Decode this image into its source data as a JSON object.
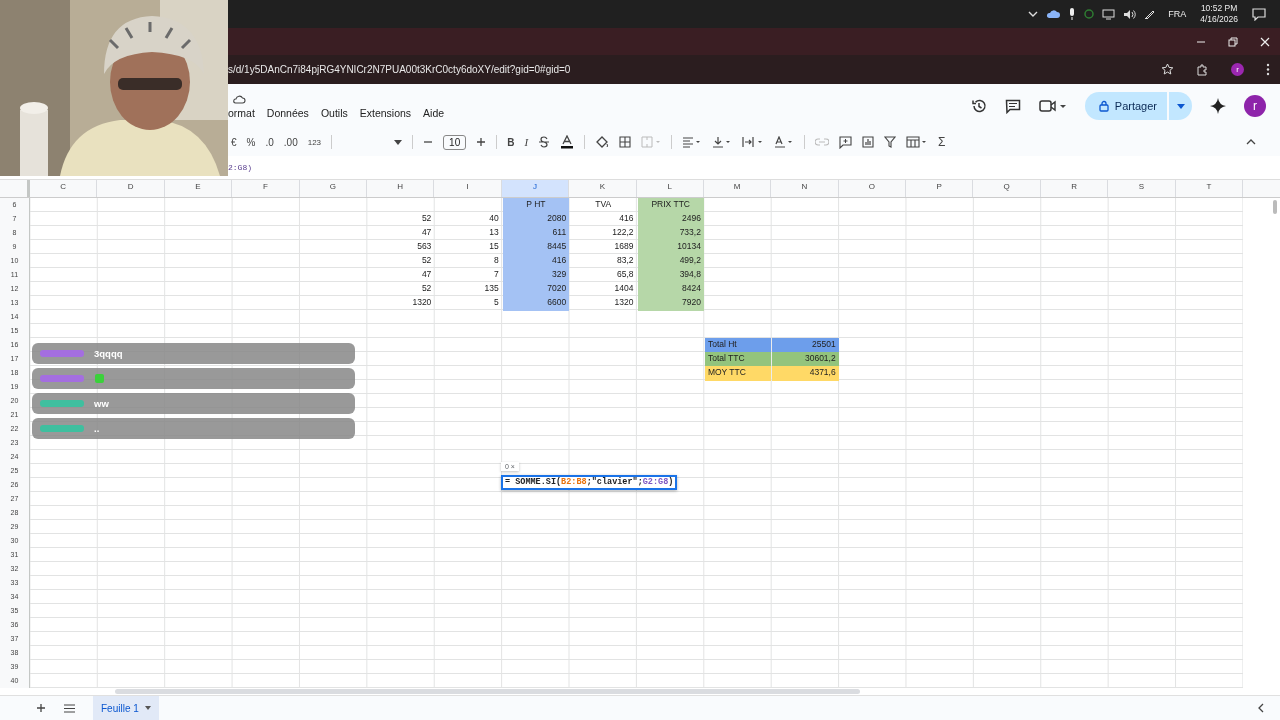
{
  "taskbar": {
    "language": "FRA",
    "time": "10:52 PM",
    "date": "4/16/2026"
  },
  "browser": {
    "url": "s/d/1y5DAnCn7i84pjRG4YNICr2N7PUA00t3KrC0cty6doXY/edit?gid=0#gid=0",
    "profile": "r"
  },
  "menu": [
    "ormat",
    "Données",
    "Outils",
    "Extensions",
    "Aide"
  ],
  "share": {
    "label": "Partager",
    "avatar": "r"
  },
  "toolbar": {
    "currency": "€",
    "percent": "%",
    "dec_less": ".0",
    "dec_more": ".00",
    "number_format": "123",
    "font_size": "10",
    "bold": "B",
    "italic": "I",
    "sum": "Σ"
  },
  "formula_bar": {
    "text": "2:G8)"
  },
  "columns": [
    {
      "label": "C",
      "selected": false
    },
    {
      "label": "D",
      "selected": false
    },
    {
      "label": "E",
      "selected": false
    },
    {
      "label": "F",
      "selected": false
    },
    {
      "label": "G",
      "selected": false
    },
    {
      "label": "H",
      "selected": false
    },
    {
      "label": "I",
      "selected": false
    },
    {
      "label": "J",
      "selected": true
    },
    {
      "label": "K",
      "selected": false
    },
    {
      "label": "L",
      "selected": false
    },
    {
      "label": "M",
      "selected": false
    },
    {
      "label": "N",
      "selected": false
    },
    {
      "label": "O",
      "selected": false
    },
    {
      "label": "P",
      "selected": false
    },
    {
      "label": "Q",
      "selected": false
    },
    {
      "label": "R",
      "selected": false
    },
    {
      "label": "S",
      "selected": false
    },
    {
      "label": "T",
      "selected": false
    }
  ],
  "rows": [
    {
      "number": "6",
      "cells": [
        null,
        null,
        null,
        null,
        null,
        null,
        null,
        {
          "text": "P HT",
          "kind": "header",
          "color": "#a4c2f4"
        },
        {
          "text": "TVA",
          "kind": "header"
        },
        {
          "text": "PRIX TTC",
          "kind": "header",
          "color": "#b6d7a8"
        }
      ]
    },
    {
      "number": "7",
      "cells": [
        null,
        null,
        null,
        null,
        null,
        {
          "text": "52",
          "kind": "number"
        },
        {
          "text": "40",
          "kind": "number"
        },
        {
          "text": "2080",
          "kind": "number",
          "color": "#a4c2f4"
        },
        {
          "text": "416",
          "kind": "number"
        },
        {
          "text": "2496",
          "kind": "number",
          "color": "#b6d7a8"
        }
      ]
    },
    {
      "number": "8",
      "cells": [
        null,
        null,
        null,
        null,
        null,
        {
          "text": "47",
          "kind": "number"
        },
        {
          "text": "13",
          "kind": "number"
        },
        {
          "text": "611",
          "kind": "number",
          "color": "#a4c2f4"
        },
        {
          "text": "122,2",
          "kind": "number"
        },
        {
          "text": "733,2",
          "kind": "number",
          "color": "#b6d7a8"
        }
      ]
    },
    {
      "number": "9",
      "cells": [
        null,
        null,
        null,
        null,
        null,
        {
          "text": "563",
          "kind": "number"
        },
        {
          "text": "15",
          "kind": "number"
        },
        {
          "text": "8445",
          "kind": "number",
          "color": "#a4c2f4"
        },
        {
          "text": "1689",
          "kind": "number"
        },
        {
          "text": "10134",
          "kind": "number",
          "color": "#b6d7a8"
        }
      ]
    },
    {
      "number": "10",
      "cells": [
        null,
        null,
        null,
        null,
        null,
        {
          "text": "52",
          "kind": "number"
        },
        {
          "text": "8",
          "kind": "number"
        },
        {
          "text": "416",
          "kind": "number",
          "color": "#a4c2f4"
        },
        {
          "text": "83,2",
          "kind": "number"
        },
        {
          "text": "499,2",
          "kind": "number",
          "color": "#b6d7a8"
        }
      ]
    },
    {
      "number": "11",
      "cells": [
        null,
        null,
        null,
        null,
        null,
        {
          "text": "47",
          "kind": "number"
        },
        {
          "text": "7",
          "kind": "number"
        },
        {
          "text": "329",
          "kind": "number",
          "color": "#a4c2f4"
        },
        {
          "text": "65,8",
          "kind": "number"
        },
        {
          "text": "394,8",
          "kind": "number",
          "color": "#b6d7a8"
        }
      ]
    },
    {
      "number": "12",
      "cells": [
        null,
        null,
        null,
        null,
        null,
        {
          "text": "52",
          "kind": "number"
        },
        {
          "text": "135",
          "kind": "number"
        },
        {
          "text": "7020",
          "kind": "number",
          "color": "#a4c2f4"
        },
        {
          "text": "1404",
          "kind": "number"
        },
        {
          "text": "8424",
          "kind": "number",
          "color": "#b6d7a8"
        }
      ]
    },
    {
      "number": "13",
      "cells": [
        null,
        null,
        null,
        null,
        null,
        {
          "text": "1320",
          "kind": "number"
        },
        {
          "text": "5",
          "kind": "number"
        },
        {
          "text": "6600",
          "kind": "number",
          "color": "#a4c2f4"
        },
        {
          "text": "1320",
          "kind": "number"
        },
        {
          "text": "7920",
          "kind": "number",
          "color": "#b6d7a8"
        }
      ]
    },
    {
      "number": "14"
    },
    {
      "number": "15"
    },
    {
      "number": "16",
      "cells": [
        null,
        null,
        null,
        null,
        null,
        null,
        null,
        null,
        null,
        null,
        {
          "text": "Total Ht",
          "kind": "label",
          "color": "#6d9eeb"
        },
        {
          "text": "25501",
          "kind": "number",
          "color": "#6d9eeb"
        }
      ]
    },
    {
      "number": "17",
      "cells": [
        null,
        null,
        null,
        null,
        null,
        null,
        null,
        null,
        null,
        null,
        {
          "text": "Total TTC",
          "kind": "label",
          "color": "#93c47d"
        },
        {
          "text": "30601,2",
          "kind": "number",
          "color": "#93c47d"
        }
      ]
    },
    {
      "number": "18",
      "cells": [
        null,
        null,
        null,
        null,
        null,
        null,
        null,
        null,
        null,
        null,
        {
          "text": "MOY TTC",
          "kind": "label",
          "color": "#ffd966"
        },
        {
          "text": "4371,6",
          "kind": "number",
          "color": "#ffd966"
        }
      ]
    },
    {
      "number": "19"
    },
    {
      "number": "20"
    },
    {
      "number": "21"
    },
    {
      "number": "22"
    },
    {
      "number": "23"
    },
    {
      "number": "24"
    },
    {
      "number": "25"
    },
    {
      "number": "26"
    },
    {
      "number": "27"
    },
    {
      "number": "28"
    },
    {
      "number": "29"
    },
    {
      "number": "30"
    },
    {
      "number": "31"
    },
    {
      "number": "32"
    },
    {
      "number": "33"
    },
    {
      "number": "34"
    },
    {
      "number": "35"
    },
    {
      "number": "36"
    },
    {
      "number": "37"
    },
    {
      "number": "38"
    },
    {
      "number": "39"
    },
    {
      "number": "40"
    }
  ],
  "cell_editor": {
    "hint": "0 ×",
    "parts": [
      {
        "text": "= SOMME.SI("
      },
      {
        "text": "B2:B8",
        "color": "#e8710a"
      },
      {
        "text": ";\"clavier\";"
      },
      {
        "text": "G2:G8",
        "color": "#7e57c2"
      },
      {
        "text": ")"
      }
    ]
  },
  "chat": [
    {
      "message": "3qqqq",
      "color": "#a46ee0",
      "kind": "text"
    },
    {
      "color": "#a46ee0",
      "kind": "emote"
    },
    {
      "message": "ww",
      "color": "#3fbf9f",
      "kind": "text"
    },
    {
      "message": "..",
      "color": "#3fbf9f",
      "kind": "text"
    }
  ],
  "sheets": [
    {
      "label": "Feuille 1",
      "selected": true
    }
  ]
}
